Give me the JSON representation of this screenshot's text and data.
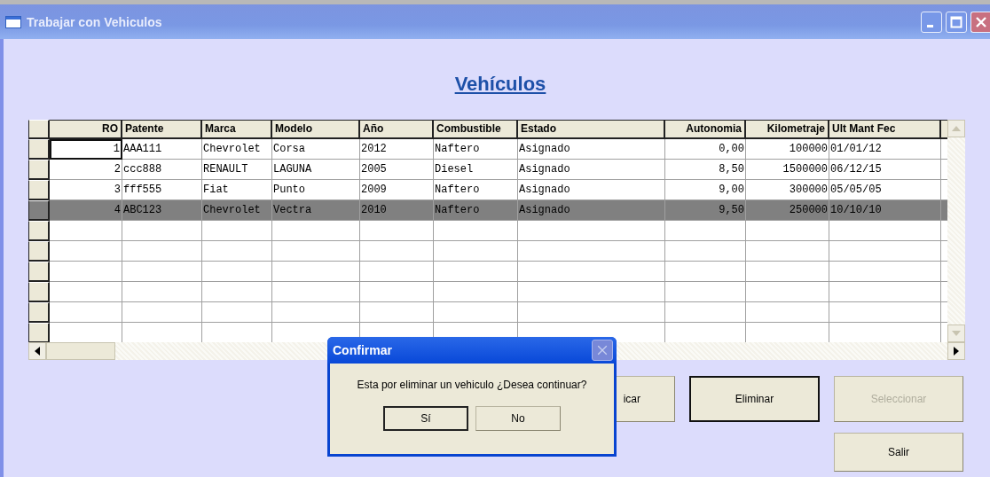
{
  "window": {
    "title": "Trabajar con Vehiculos"
  },
  "heading": "Vehículos",
  "grid": {
    "columns": [
      {
        "label": "RO"
      },
      {
        "label": "Patente"
      },
      {
        "label": "Marca"
      },
      {
        "label": "Modelo"
      },
      {
        "label": "Año"
      },
      {
        "label": "Combustible"
      },
      {
        "label": "Estado"
      },
      {
        "label": "Autonomia"
      },
      {
        "label": "Kilometraje"
      },
      {
        "label": "Ult Mant Fec"
      }
    ],
    "rows": [
      {
        "selected": false,
        "focused": true,
        "cells": [
          "1",
          "AAA111",
          "Chevrolet",
          "Corsa",
          "2012",
          "Naftero",
          "Asignado",
          "0,00",
          "100000",
          "01/01/12"
        ]
      },
      {
        "selected": false,
        "focused": false,
        "cells": [
          "2",
          "ccc888",
          "RENAULT",
          "LAGUNA",
          "2005",
          "Diesel",
          "Asignado",
          "8,50",
          "1500000",
          "06/12/15"
        ]
      },
      {
        "selected": false,
        "focused": false,
        "cells": [
          "3",
          "fff555",
          "Fiat",
          "Punto",
          "2009",
          "Naftero",
          "Asignado",
          "9,00",
          "300000",
          "05/05/05"
        ]
      },
      {
        "selected": true,
        "focused": false,
        "cells": [
          "4",
          "ABC123",
          "Chevrolet",
          "Vectra",
          "2010",
          "Naftero",
          "Asignado",
          "9,50",
          "250000",
          "10/10/10"
        ]
      }
    ]
  },
  "buttons": [
    {
      "label": "icar",
      "disabled": false,
      "focused": false
    },
    {
      "label": "Eliminar",
      "disabled": false,
      "focused": true
    },
    {
      "label": "Seleccionar",
      "disabled": true,
      "focused": false
    },
    {
      "label": "Salir",
      "disabled": false,
      "focused": false
    }
  ],
  "dialog": {
    "title": "Confirmar",
    "message": "Esta por eliminar un vehiculo ¿Desea continuar?",
    "buttons": [
      {
        "label": "Sí",
        "focused": true
      },
      {
        "label": "No",
        "focused": false
      }
    ]
  }
}
